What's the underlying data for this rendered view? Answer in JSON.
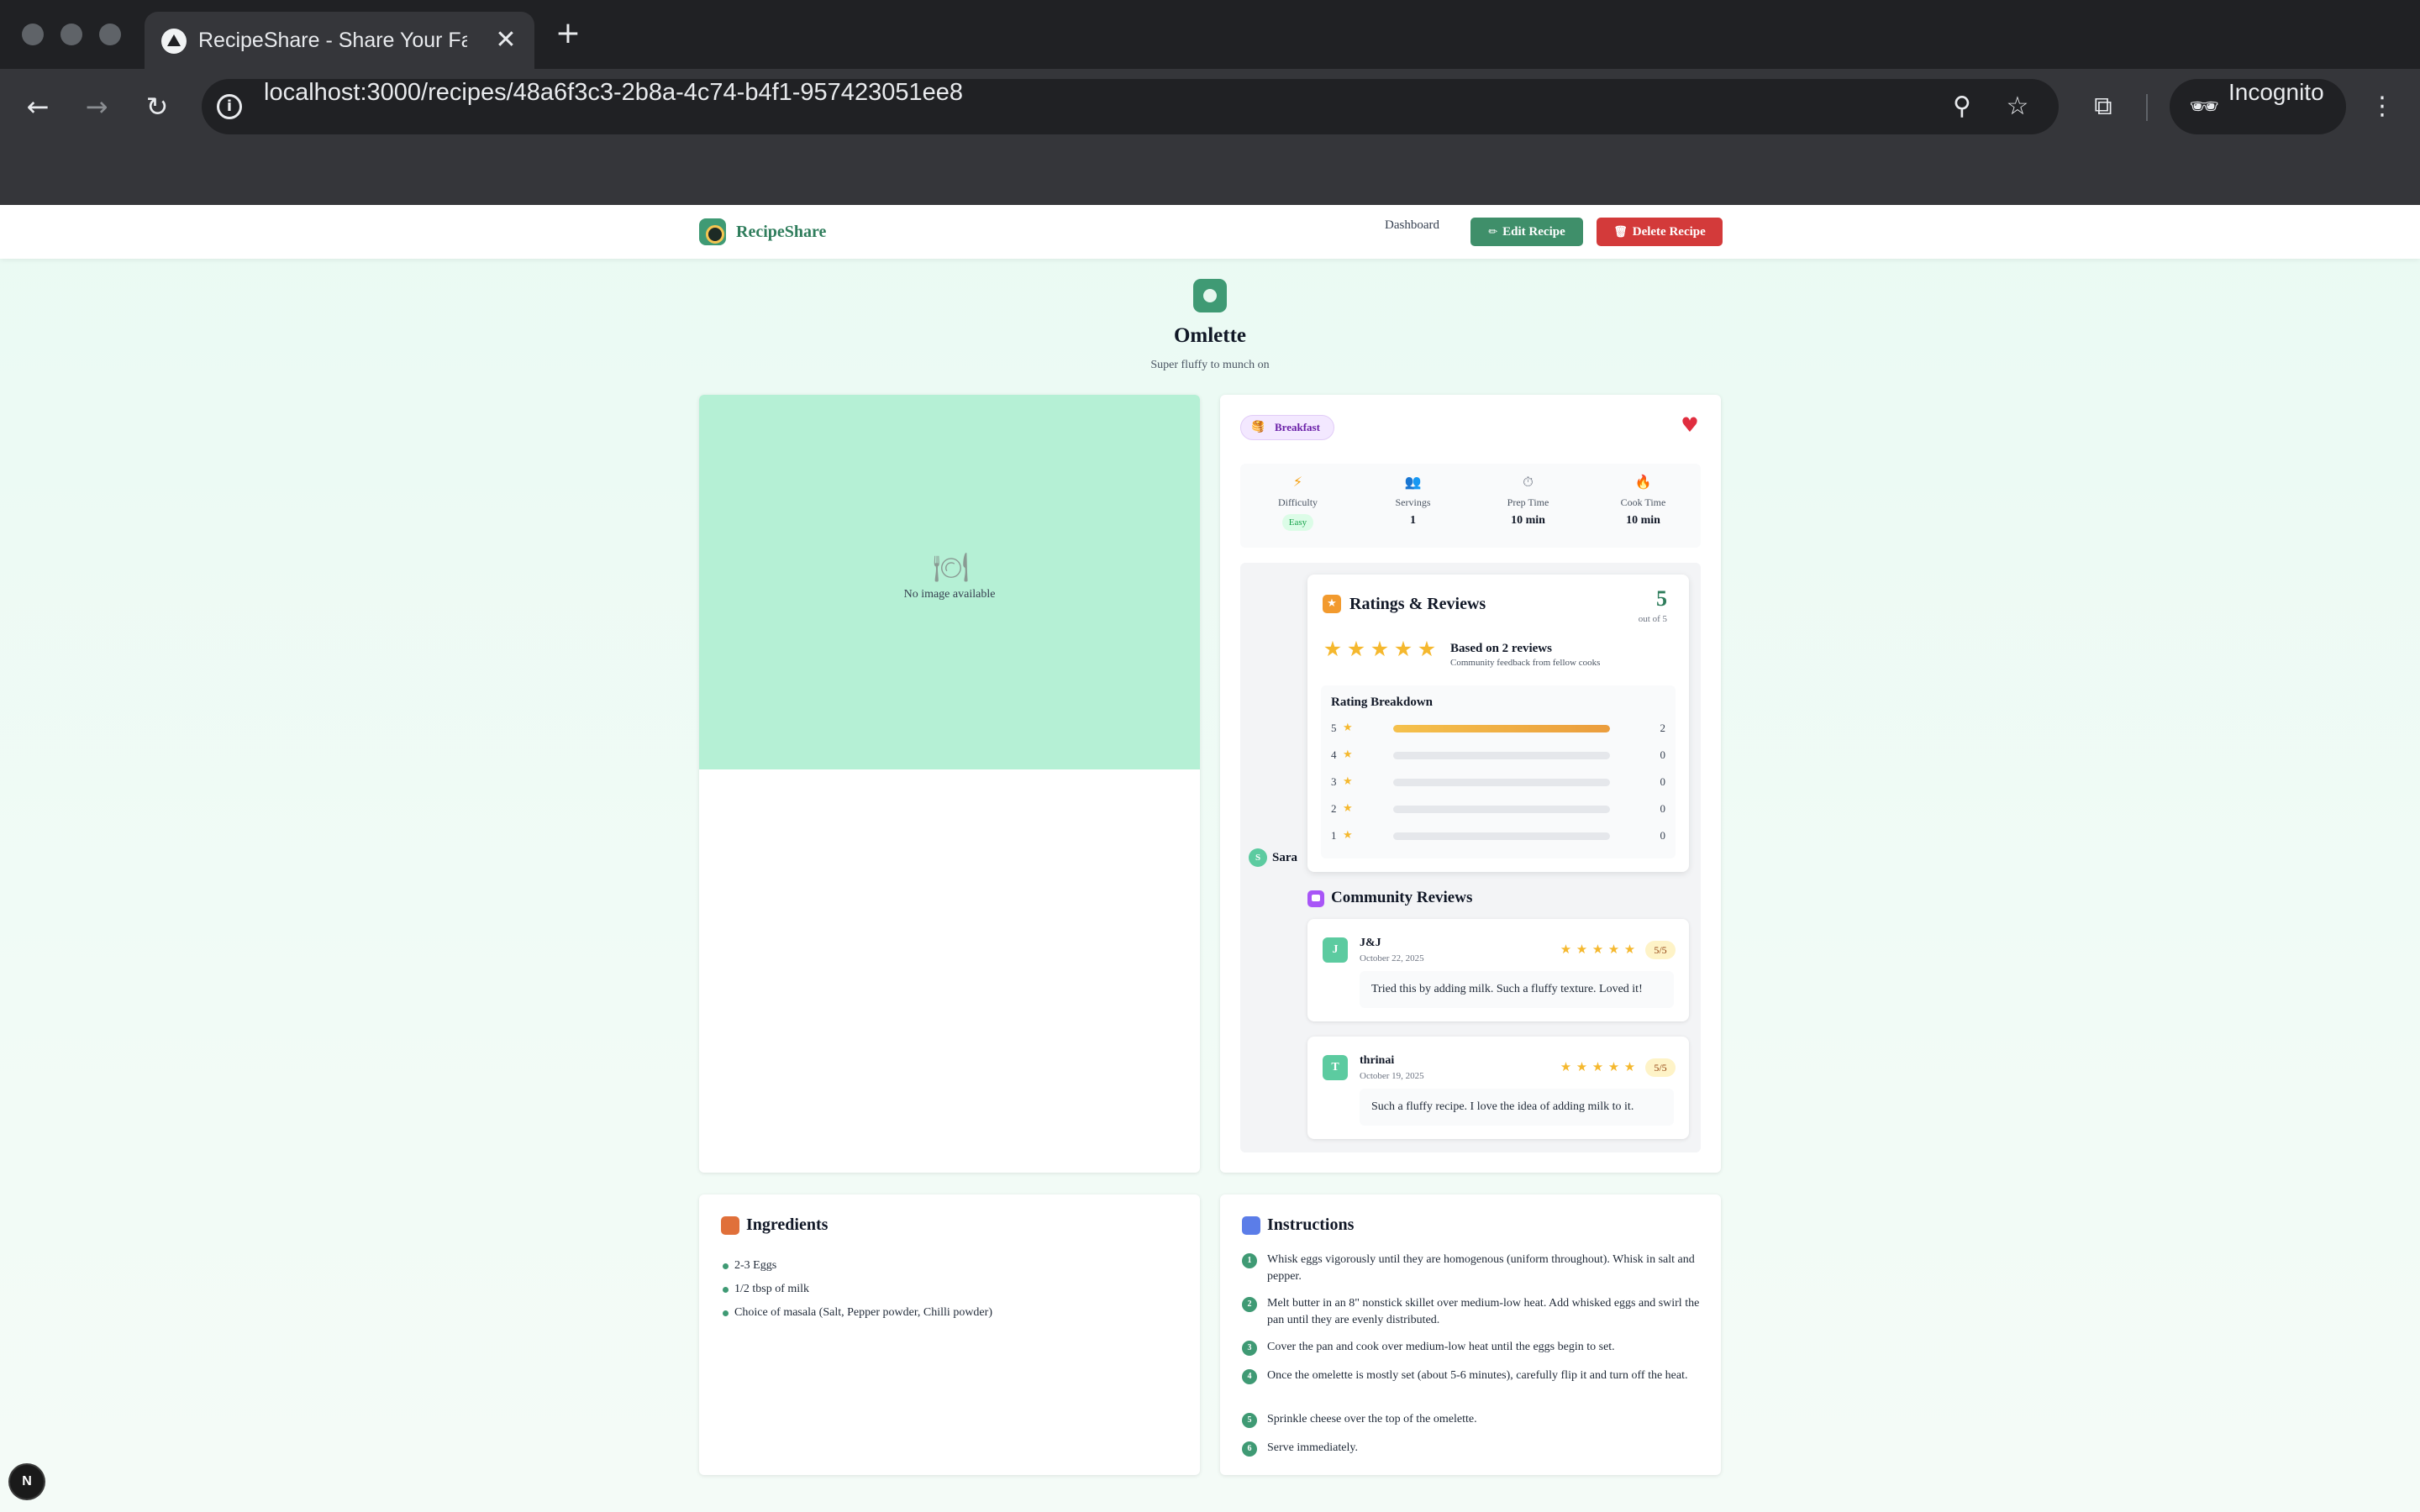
{
  "browser": {
    "tab_title": "RecipeShare - Share Your Favorite Recipes",
    "tab_close": "✕",
    "new_tab": "+",
    "url": "localhost:3000/recipes/48a6f3c3-2b8a-4c74-b4f1-957423051ee8",
    "incognito_label": "Incognito",
    "icons": [
      "back-arrow-icon",
      "forward-arrow-icon",
      "reload-icon",
      "site-info-icon",
      "zoom-icon",
      "bookmark-star-icon",
      "tab-search-icon",
      "incognito-icon",
      "kebab-menu-icon"
    ]
  },
  "header": {
    "brand": "RecipeShare",
    "nav_dashboard": "Dashboard",
    "edit_label": "Edit Recipe",
    "delete_label": "Delete Recipe",
    "edit_icon": "✏",
    "delete_icon": "🗑"
  },
  "recipe": {
    "title": "Omlette",
    "subtitle": "Super fluffy to munch on",
    "no_image": "No image available",
    "category": "Breakfast",
    "category_icon": "🥞",
    "stats": [
      {
        "icon": "⚡",
        "label": "Difficulty",
        "value": "Easy"
      },
      {
        "icon": "👥",
        "label": "Servings",
        "value": "1"
      },
      {
        "icon": "⏱",
        "label": "Prep Time",
        "value": "10 min"
      },
      {
        "icon": "🔥",
        "label": "Cook Time",
        "value": "10 min"
      }
    ],
    "author_initial": "S",
    "author_name": "Sara"
  },
  "ratings": {
    "title": "Ratings & Reviews",
    "average": "5",
    "out_of": "out of 5",
    "stars": 5,
    "based_on": "Based on 2 reviews",
    "community_feedback": "Community feedback from fellow cooks",
    "breakdown_title": "Rating Breakdown",
    "breakdown": [
      {
        "stars": "5",
        "count": "2",
        "fraction": 1.0
      },
      {
        "stars": "4",
        "count": "0",
        "fraction": 0
      },
      {
        "stars": "3",
        "count": "0",
        "fraction": 0
      },
      {
        "stars": "2",
        "count": "0",
        "fraction": 0
      },
      {
        "stars": "1",
        "count": "0",
        "fraction": 0
      }
    ]
  },
  "community": {
    "title": "Community Reviews",
    "reviews": [
      {
        "initial": "J",
        "name": "J&J",
        "date": "October 22, 2025",
        "score": "5/5",
        "stars": 5,
        "text": "Tried this by adding milk. Such a fluffy texture. Loved it!"
      },
      {
        "initial": "T",
        "name": "thrinai",
        "date": "October 19, 2025",
        "score": "5/5",
        "stars": 5,
        "text": "Such a fluffy recipe. I love the idea of adding milk to it."
      }
    ]
  },
  "ingredients": {
    "title": "Ingredients",
    "items": [
      "2-3 Eggs",
      "1/2 tbsp of milk",
      "Choice of masala (Salt, Pepper powder, Chilli powder)"
    ]
  },
  "instructions": {
    "title": "Instructions",
    "steps": [
      {
        "num": "1",
        "text": "Whisk eggs vigorously until they are homogenous (uniform throughout). Whisk in salt and pepper."
      },
      {
        "num": "2",
        "text": "Melt butter in an 8\" nonstick skillet over medium-low heat. Add whisked eggs and swirl the pan until they are evenly distributed."
      },
      {
        "num": "3",
        "text": "Cover the pan and cook over medium-low heat until the eggs begin to set."
      },
      {
        "num": "4",
        "text": "Once the omelette is mostly set (about 5-6 minutes), carefully flip it and turn off the heat."
      },
      {
        "num": "5",
        "text": "Sprinkle cheese over the top of the omelette."
      },
      {
        "num": "6",
        "text": "Serve immediately."
      }
    ]
  },
  "dev_badge": "N",
  "colors": {
    "brand_green": "#3f9a74",
    "delete_red": "#d33a3a",
    "star_gold": "#f5b82e",
    "heart_red": "#e02e3f",
    "image_placeholder": "#b5f0d5"
  }
}
